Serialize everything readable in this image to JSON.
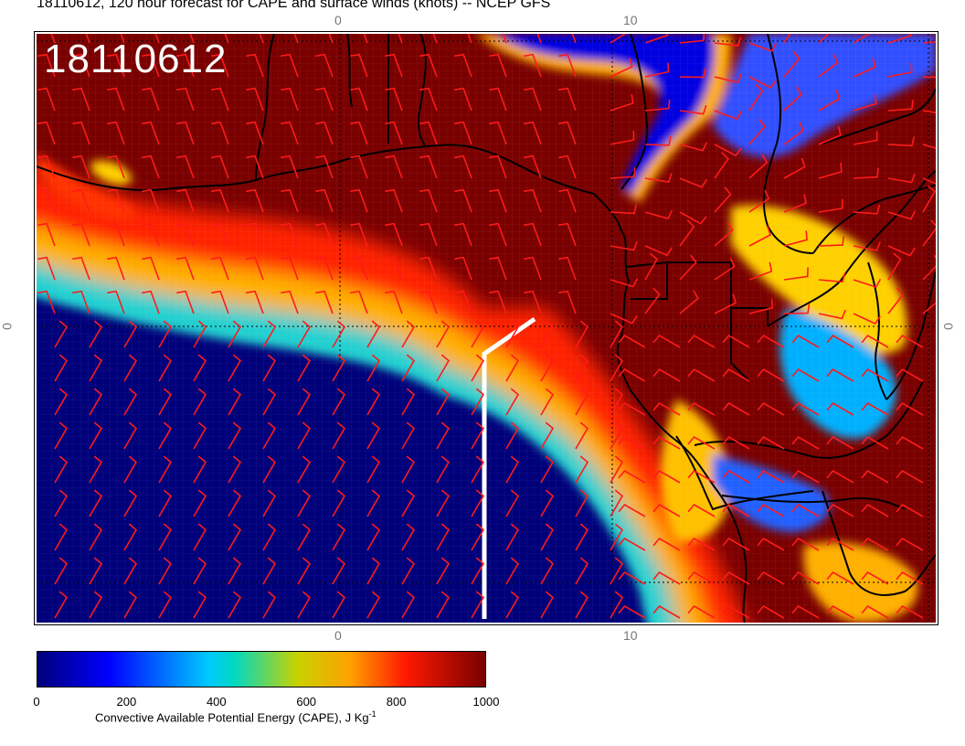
{
  "header": {
    "title": "18110612, 120 hour forecast for CAPE and surface winds (knots) -- NCEP GFS",
    "stamp": "18110612"
  },
  "map": {
    "lon_labels": [
      {
        "text": "0",
        "edge": "top"
      },
      {
        "text": "10",
        "edge": "top"
      },
      {
        "text": "0",
        "edge": "bottom"
      },
      {
        "text": "10",
        "edge": "bottom"
      }
    ],
    "lat_labels": [
      {
        "text": "0",
        "edge": "left"
      },
      {
        "text": "0",
        "edge": "right"
      }
    ],
    "colors": {
      "high_cape": "#7a0000",
      "low_cape": "#00007a",
      "wind_barb": "#ff1a1a",
      "coastline": "#000000",
      "cross_section": "#ffffff"
    }
  },
  "colorbar": {
    "ticks": [
      "0",
      "200",
      "400",
      "600",
      "800",
      "1000"
    ],
    "tick_values": [
      0,
      200,
      400,
      600,
      800,
      1000
    ],
    "min": 0,
    "max": 1000,
    "label_main": "Convective Available Potential Energy (CAPE), J Kg",
    "label_sup": "-1"
  }
}
